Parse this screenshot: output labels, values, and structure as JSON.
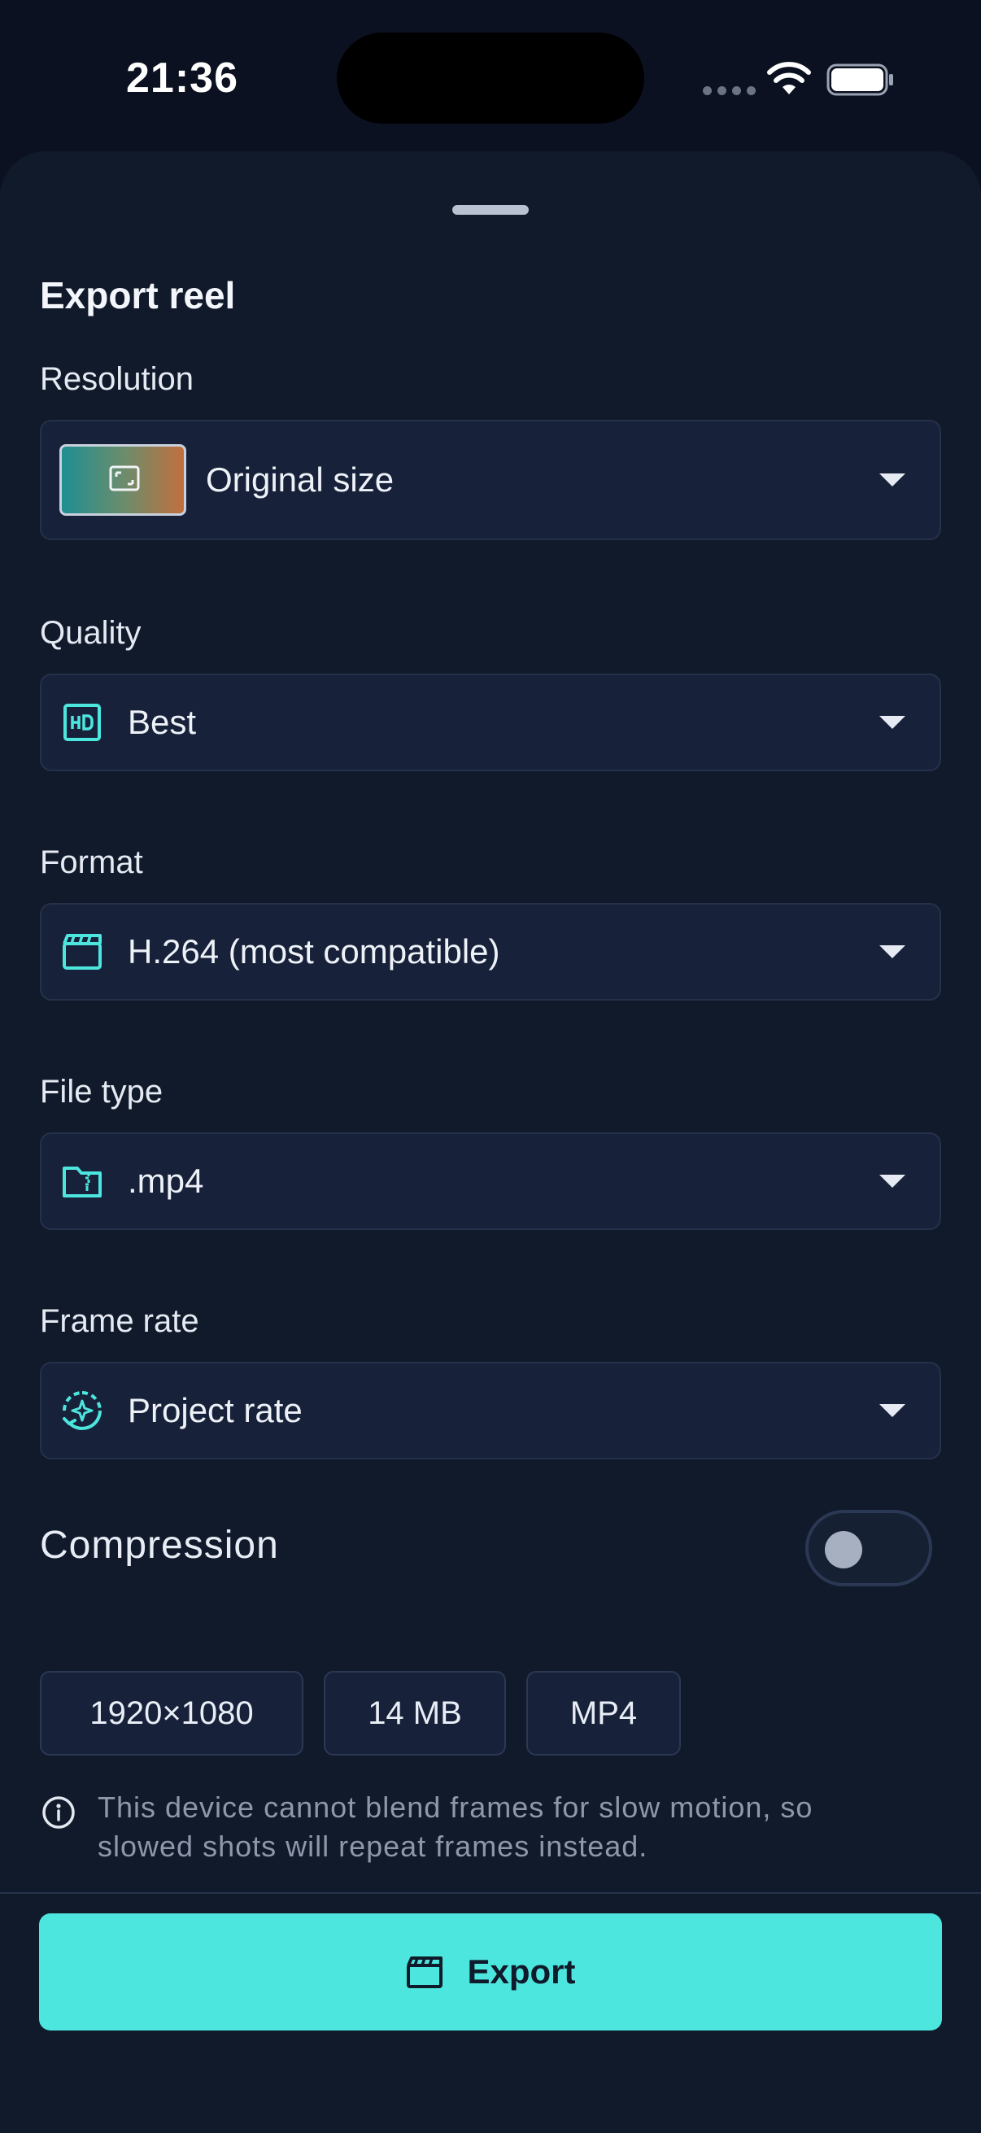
{
  "status": {
    "time": "21:36"
  },
  "sheet": {
    "title": "Export reel",
    "resolution": {
      "label": "Resolution",
      "value": "Original size",
      "icon": "image-thumbnail-icon"
    },
    "quality": {
      "label": "Quality",
      "value": "Best",
      "icon": "hd-icon"
    },
    "format": {
      "label": "Format",
      "value": "H.264 (most compatible)",
      "icon": "clapperboard-icon"
    },
    "file_type": {
      "label": "File type",
      "value": ".mp4",
      "icon": "folder-zip-icon"
    },
    "frame_rate": {
      "label": "Frame rate",
      "value": "Project rate",
      "icon": "sparkle-refresh-icon"
    },
    "compression": {
      "label": "Compression",
      "enabled": false
    },
    "chips": [
      "1920×1080",
      "14 MB",
      "MP4"
    ],
    "info": "This device cannot blend frames for slow motion, so slowed shots will repeat frames instead.",
    "export_label": "Export"
  },
  "colors": {
    "accent": "#4de6de",
    "sheet_bg": "#111a2b",
    "field_bg": "#17223a"
  }
}
